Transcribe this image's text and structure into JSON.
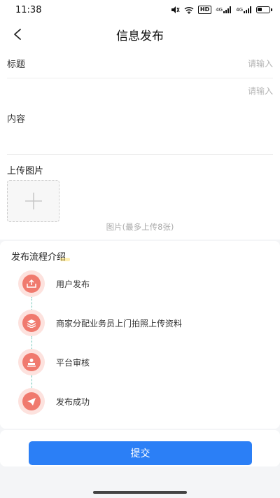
{
  "status_bar": {
    "time": "11:38",
    "icons": [
      "mute-icon",
      "wifi-icon",
      "hd-badge",
      "signal-4g-icon",
      "signal-4g-icon",
      "battery-icon"
    ],
    "hd_label": "HD",
    "net1_label": "4G",
    "net2_label": "4G"
  },
  "nav": {
    "title": "信息发布",
    "back_icon": "chevron-left-icon"
  },
  "form": {
    "title_label": "标题",
    "title_placeholder": "请输入",
    "content_label": "内容",
    "content_placeholder": "请输入",
    "upload_label": "上传图片",
    "upload_icon": "plus-icon",
    "upload_hint": "图片(最多上传8张)"
  },
  "flow": {
    "title": "发布流程介绍",
    "accent_color": "#f07a6e",
    "steps": [
      {
        "label": "用户发布",
        "icon": "upload-icon"
      },
      {
        "label": "商家分配业务员上门拍照上传资料",
        "icon": "layers-icon"
      },
      {
        "label": "平台审核",
        "icon": "stamp-icon"
      },
      {
        "label": "发布成功",
        "icon": "send-icon"
      }
    ]
  },
  "submit": {
    "label": "提交",
    "color": "#2b7ff6"
  }
}
